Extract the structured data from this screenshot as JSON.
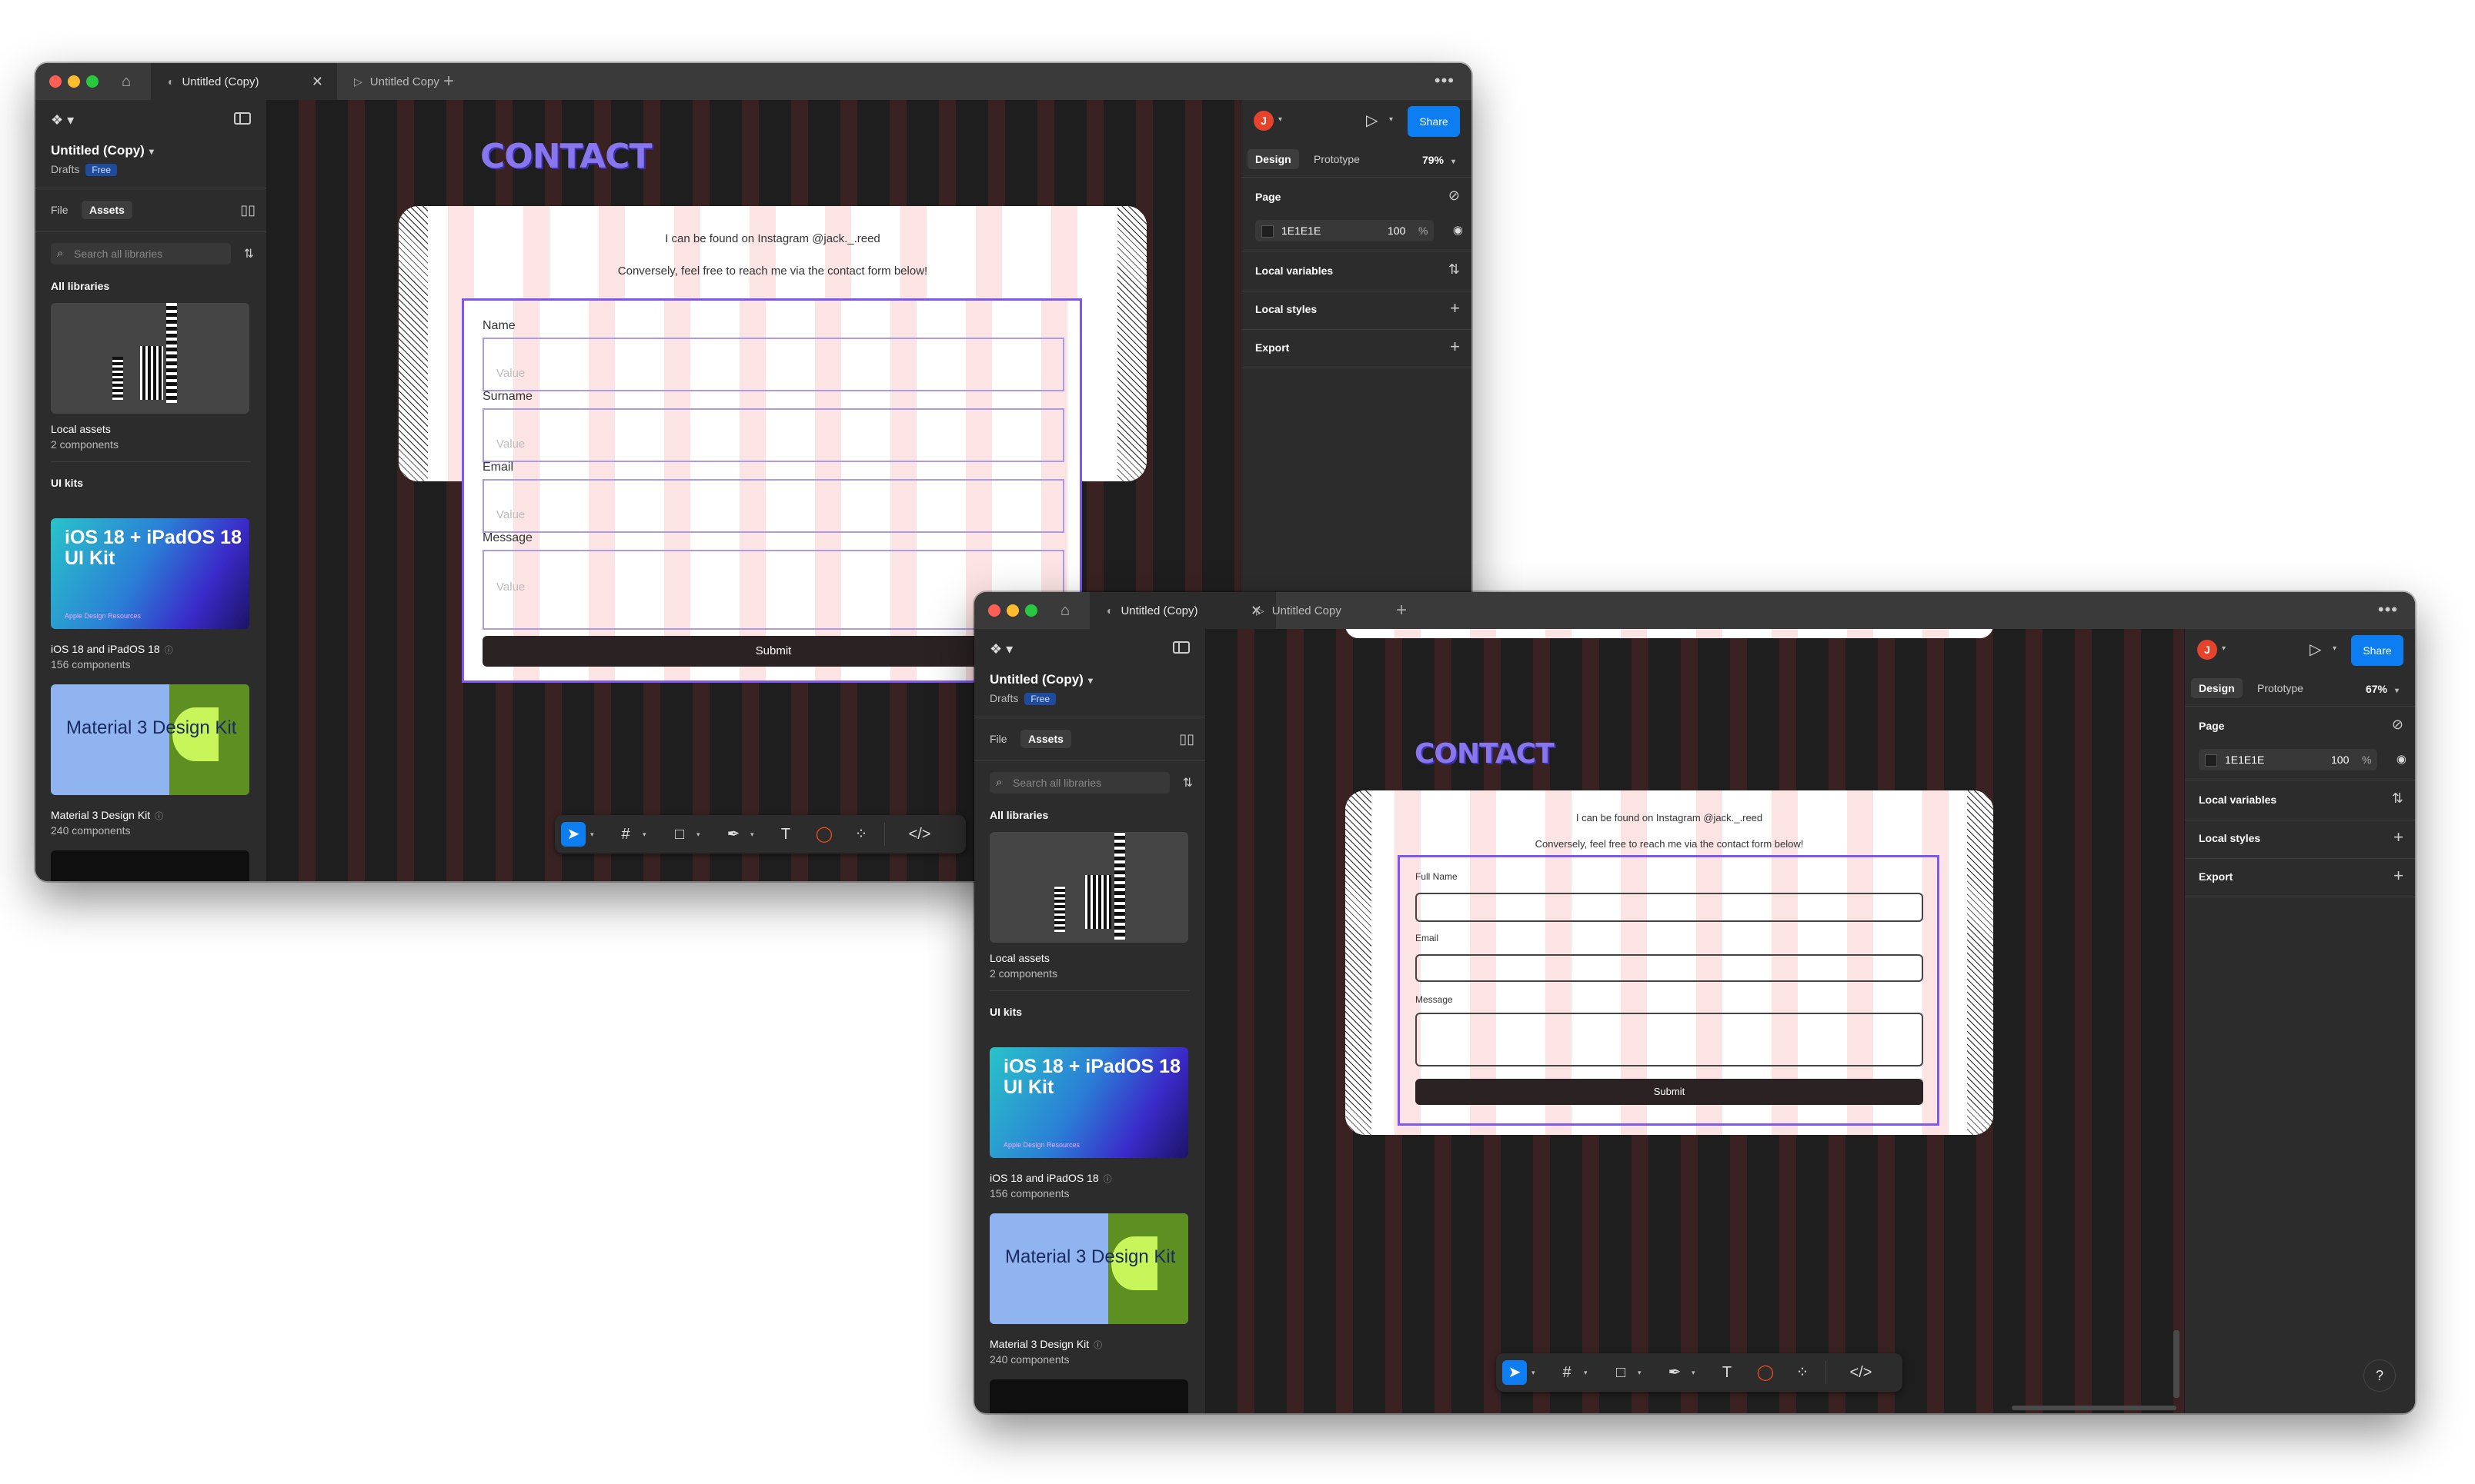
{
  "windows": [
    {
      "tabs": {
        "active": "Untitled (Copy)",
        "inactive": "Untitled Copy"
      },
      "file": {
        "title": "Untitled (Copy)",
        "location": "Drafts",
        "plan": "Free"
      },
      "left_tabs": {
        "file": "File",
        "assets": "Assets"
      },
      "search_placeholder": "Search all libraries",
      "libraries": {
        "all_heading": "All libraries",
        "local_name": "Local assets",
        "local_count": "2 components",
        "ui_kits_heading": "UI kits",
        "ios_card": "iOS 18 + iPadOS 18 UI Kit",
        "ios_card_sub": "Apple Design Resources",
        "ios_name": "iOS 18 and iPadOS 18",
        "ios_count": "156 components",
        "material_card": "Material 3 Design Kit",
        "material_name": "Material 3 Design Kit",
        "material_count": "240 components"
      },
      "right": {
        "avatar": "J",
        "share": "Share",
        "tab_design": "Design",
        "tab_prototype": "Prototype",
        "zoom": "79%",
        "page_heading": "Page",
        "page_color": "1E1E1E",
        "page_opacity": "100",
        "page_opacity_unit": "%",
        "local_variables": "Local variables",
        "local_styles": "Local styles",
        "export": "Export"
      },
      "canvas": {
        "heading": "CONTACT",
        "line1": "I can be found on Instagram @jack._.reed",
        "line2": "Conversely, feel free to reach me via the contact form below!",
        "fields": [
          {
            "label": "Name",
            "value": "Value"
          },
          {
            "label": "Surname",
            "value": "Value"
          },
          {
            "label": "Email",
            "value": "Value"
          },
          {
            "label": "Message",
            "value": "Value"
          }
        ],
        "submit": "Submit"
      }
    },
    {
      "tabs": {
        "active": "Untitled (Copy)",
        "inactive": "Untitled Copy"
      },
      "file": {
        "title": "Untitled (Copy)",
        "location": "Drafts",
        "plan": "Free"
      },
      "left_tabs": {
        "file": "File",
        "assets": "Assets"
      },
      "search_placeholder": "Search all libraries",
      "libraries": {
        "all_heading": "All libraries",
        "local_name": "Local assets",
        "local_count": "2 components",
        "ui_kits_heading": "UI kits",
        "ios_card": "iOS 18 + iPadOS 18 UI Kit",
        "ios_card_sub": "Apple Design Resources",
        "ios_name": "iOS 18 and iPadOS 18",
        "ios_count": "156 components",
        "material_card": "Material 3 Design Kit",
        "material_name": "Material 3 Design Kit",
        "material_count": "240 components"
      },
      "right": {
        "avatar": "J",
        "share": "Share",
        "tab_design": "Design",
        "tab_prototype": "Prototype",
        "zoom": "67%",
        "page_heading": "Page",
        "page_color": "1E1E1E",
        "page_opacity": "100",
        "page_opacity_unit": "%",
        "local_variables": "Local variables",
        "local_styles": "Local styles",
        "export": "Export"
      },
      "canvas": {
        "heading": "CONTACT",
        "line1": "I can be found on Instagram @jack._.reed",
        "line2": "Conversely, feel free to reach me via the contact form below!",
        "fields": [
          {
            "label": "Full Name"
          },
          {
            "label": "Email"
          },
          {
            "label": "Message"
          }
        ],
        "submit": "Submit"
      },
      "help": "?"
    }
  ]
}
